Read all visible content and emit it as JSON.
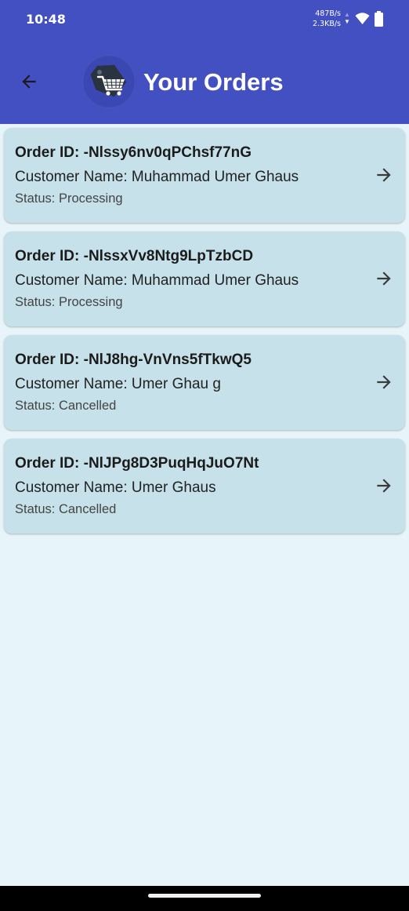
{
  "status_bar": {
    "time": "10:48",
    "upload_speed": "487B/s",
    "download_speed": "2.3KB/s",
    "icons": [
      "network-speed-icon",
      "wifi-icon",
      "battery-icon"
    ]
  },
  "app_bar": {
    "title": "Your Orders",
    "back_icon": "arrow-back-icon",
    "logo_icon": "shopping-cart-tag-icon",
    "background_color": "#4250c2"
  },
  "orders": [
    {
      "id_text": "Order ID: -Nlssy6nv0qPChsf77nG",
      "customer_text": "Customer Name: Muhammad Umer Ghaus",
      "status_text": "Status: Processing"
    },
    {
      "id_text": "Order ID: -NlssxVv8Ntg9LpTzbCD",
      "customer_text": "Customer Name: Muhammad Umer Ghaus",
      "status_text": "Status: Processing"
    },
    {
      "id_text": "Order ID: -NlJ8hg-VnVns5fTkwQ5",
      "customer_text": "Customer Name: Umer Ghau g",
      "status_text": "Status: Cancelled"
    },
    {
      "id_text": "Order ID: -NlJPg8D3PuqHqJuO7Nt",
      "customer_text": "Customer Name: Umer Ghaus",
      "status_text": "Status: Cancelled"
    }
  ],
  "colors": {
    "card_background": "#c6e1ea",
    "page_background": "#e7f4f9"
  }
}
